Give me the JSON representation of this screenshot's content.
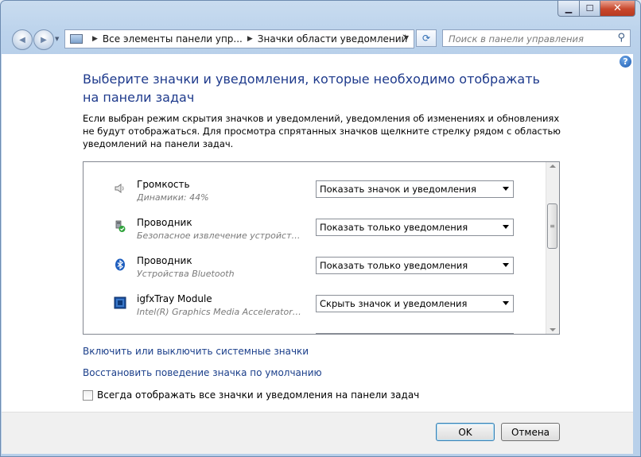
{
  "window": {
    "min_label": "▁",
    "max_label": "☐",
    "close_label": "✕"
  },
  "nav": {
    "back_icon": "◀",
    "forward_icon": "▶",
    "breadcrumb_root": "Все элементы панели упр...",
    "breadcrumb_current": "Значки области уведомлений",
    "refresh_icon": "⟳",
    "search_placeholder": "Поиск в панели управления"
  },
  "page": {
    "title": "Выберите значки и уведомления, которые необходимо отображать на панели задач",
    "description": "Если выбран режим скрытия значков и уведомлений, уведомления об изменениях и обновлениях не будут отображаться. Для просмотра спрятанных значков щелкните стрелку рядом с областью уведомлений на панели задач."
  },
  "items": [
    {
      "icon": "speaker-icon",
      "name": "Громкость",
      "subtitle": "Динамики: 44%",
      "behavior": "Показать значок и уведомления"
    },
    {
      "icon": "usb-safe-remove-icon",
      "name": "Проводник",
      "subtitle": "Безопасное извлечение устройств...",
      "behavior": "Показать только уведомления"
    },
    {
      "icon": "bluetooth-icon",
      "name": "Проводник",
      "subtitle": "Устройства Bluetooth",
      "behavior": "Показать только уведомления"
    },
    {
      "icon": "intel-graphics-icon",
      "name": "igfxTray Module",
      "subtitle": "Intel(R) Graphics Media Accelerator D...",
      "behavior": "Скрыть значок и уведомления"
    }
  ],
  "links": {
    "system_icons": "Включить или выключить системные значки",
    "restore_default": "Восстановить поведение значка по умолчанию"
  },
  "always_show": {
    "label": "Всегда отображать все значки и уведомления на панели задач",
    "checked": false
  },
  "buttons": {
    "ok": "OK",
    "cancel": "Отмена"
  },
  "colors": {
    "title": "#1e3a8c",
    "link": "#1a3e8a",
    "window_frame": "#b8d0ea"
  }
}
